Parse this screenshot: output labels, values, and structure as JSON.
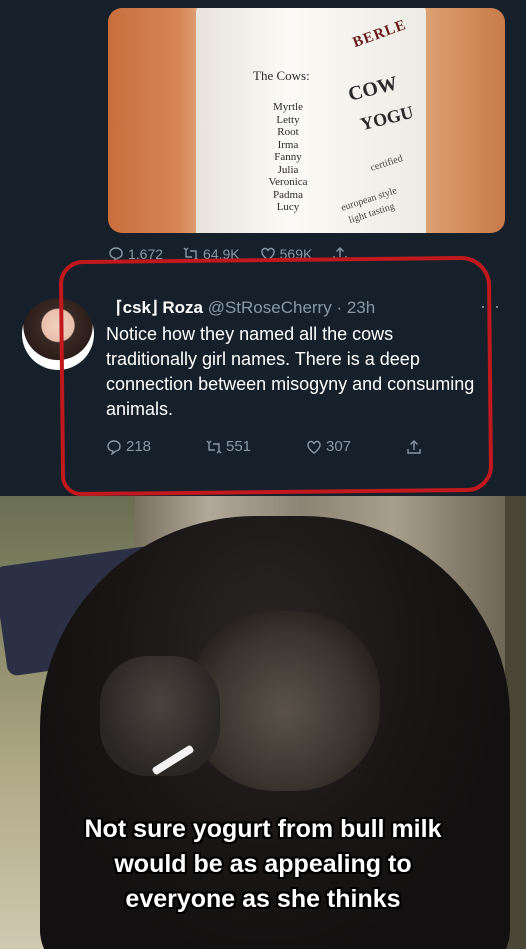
{
  "photo": {
    "heading": "The Cows:",
    "cows": [
      "Myrtle",
      "Letty",
      "Root",
      "Irma",
      "Fanny",
      "Julia",
      "Veronica",
      "Padma",
      "Lucy"
    ],
    "brand": "BERLE",
    "product_line1": "COW",
    "product_line2": "YOGU",
    "certified": "certified",
    "style_line1": "european style",
    "style_line2": "light tasting"
  },
  "first_tweet_actions": {
    "replies": "1,672",
    "retweets": "64.9K",
    "likes": "569K"
  },
  "tweet": {
    "display_name": "⌈csk⌋ Roza",
    "handle": "@StRoseCherry",
    "time": "· 23h",
    "more": "···",
    "text": "Notice how they named all the cows traditionally girl names. There is a deep connection between misogyny and consuming animals.",
    "replies": "218",
    "retweets": "551",
    "likes": "307"
  },
  "highlight_color": "#c0181c",
  "meme": {
    "caption_line1": "Not sure yogurt from bull milk",
    "caption_line2": "would be as appealing to",
    "caption_line3": "everyone as she thinks"
  }
}
